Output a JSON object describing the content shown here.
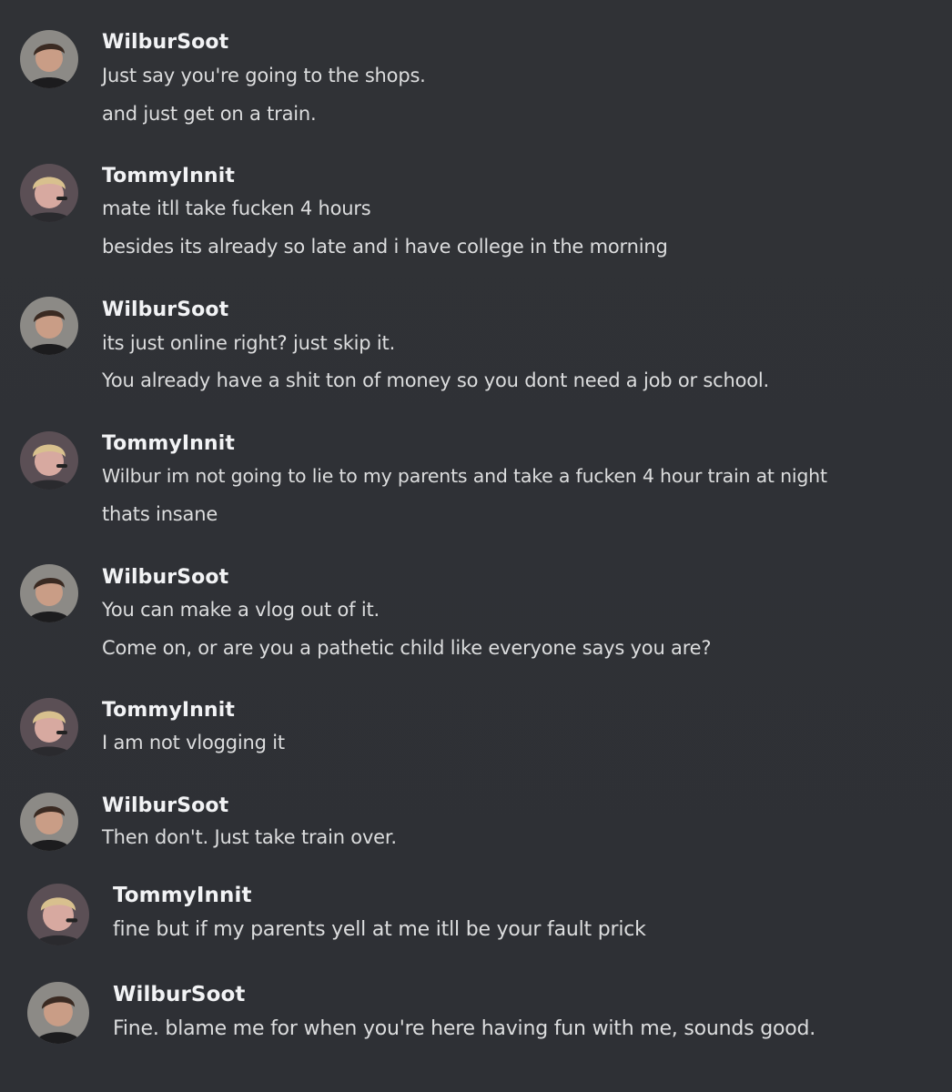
{
  "messages": [
    {
      "author": "WilburSoot",
      "avatar": "wilbur-avatar",
      "lines": [
        "Just say you're going to the shops.",
        "and just get on a train."
      ]
    },
    {
      "author": "TommyInnit",
      "avatar": "tommy-avatar",
      "lines": [
        "mate itll take fucken 4 hours",
        "besides its already so late and i have college in the morning"
      ]
    },
    {
      "author": "WilburSoot",
      "avatar": "wilbur-avatar",
      "lines": [
        "its just online right? just skip it.",
        "You already have a shit ton of money so you dont need a job or school."
      ]
    },
    {
      "author": "TommyInnit",
      "avatar": "tommy-avatar",
      "lines": [
        "Wilbur im not going to lie to my parents and take a fucken 4 hour train at night",
        "thats insane"
      ]
    },
    {
      "author": "WilburSoot",
      "avatar": "wilbur-avatar",
      "lines": [
        "You can make a vlog out of it.",
        "Come on, or are you a pathetic child like everyone says you are?"
      ]
    },
    {
      "author": "TommyInnit",
      "avatar": "tommy-avatar",
      "lines": [
        "I am not vlogging it"
      ]
    },
    {
      "author": "WilburSoot",
      "avatar": "wilbur-avatar",
      "lines": [
        "Then don't. Just take train over."
      ]
    },
    {
      "author": "TommyInnit",
      "avatar": "tommy-avatar",
      "lines": [
        "fine but if my parents yell at me itll be your fault prick"
      ]
    },
    {
      "author": "WilburSoot",
      "avatar": "wilbur-avatar",
      "lines": [
        "Fine. blame me for when you're here having fun with me, sounds good."
      ]
    }
  ]
}
